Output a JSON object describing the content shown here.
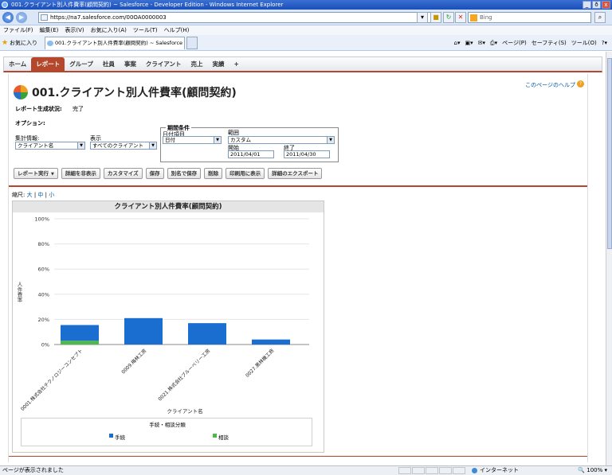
{
  "browser": {
    "window_title": "001.クライアント別人件費率(顧問契約) ~ Salesforce - Developer Edition - Windows Internet Explorer",
    "window_controls": [
      "_",
      "ð",
      "x"
    ],
    "url": "https://na7.salesforce.com/00OA0000003",
    "search_placeholder": "Bing",
    "menu": [
      "ファイル(F)",
      "編集(E)",
      "表示(V)",
      "お気に入り(A)",
      "ツール(T)",
      "ヘルプ(H)"
    ],
    "favorites_label": "お気に入り",
    "tab_title": "001.クライアント別人件費率(顧問契約) ~ Salesforce ...",
    "command_bar": [
      "ページ(P)",
      "セーフティ(S)",
      "ツール(O)"
    ],
    "status_text": "ページが表示されました",
    "zone": "インターネット",
    "zoom": "100%"
  },
  "sf_tabs": [
    {
      "label": "ホーム",
      "active": false
    },
    {
      "label": "レポート",
      "active": true
    },
    {
      "label": "グループ",
      "active": false
    },
    {
      "label": "社員",
      "active": false
    },
    {
      "label": "事案",
      "active": false
    },
    {
      "label": "クライアント",
      "active": false
    },
    {
      "label": "売上",
      "active": false
    },
    {
      "label": "実績",
      "active": false
    },
    {
      "label": "+",
      "active": false
    }
  ],
  "page": {
    "title": "001.クライアント別人件費率(顧問契約)",
    "help_link": "このページのヘルプ",
    "report_status_label": "レポート生成状況:",
    "report_status_value": "完了",
    "options_label": "オプション:",
    "summary_label": "集計情報:",
    "summary_value": "クライアント名",
    "show_label": "表示",
    "show_value": "すべてのクライアント",
    "period_legend": "期間条件",
    "date_field_label": "日付項目",
    "date_field_value": "日付",
    "range_label": "範囲",
    "range_value": "カスタム",
    "start_label": "開始",
    "start_value": "2011/04/01",
    "end_label": "終了",
    "end_value": "2011/04/30"
  },
  "buttons": {
    "run": "レポート実行",
    "hide_details": "詳細を非表示",
    "customize": "カスタマイズ",
    "save": "保存",
    "save_as": "別名で保存",
    "delete": "削除",
    "printable": "印刷用に表示",
    "export": "詳細のエクスポート"
  },
  "size_links": {
    "label": "縮尺:",
    "large": "大",
    "medium": "中",
    "small": "小"
  },
  "chart_data": {
    "type": "bar",
    "stacked": true,
    "title": "クライアント別人件費率(顧問契約)",
    "xlabel": "クライアント名",
    "ylabel": "人件費率",
    "ylim": [
      0,
      100
    ],
    "yticks": [
      "0%",
      "20%",
      "40%",
      "60%",
      "80%",
      "100%"
    ],
    "categories": [
      "0001.株式会社テクノロジーコンセプト",
      "0009.梅林工房",
      "0021.株式会社ブルーベリー工房",
      "0027.黒林機工商"
    ],
    "series": [
      {
        "name": "相談",
        "color": "#4fb84a",
        "values": [
          3,
          0,
          0,
          0
        ]
      },
      {
        "name": "手続",
        "color": "#1a6ed0",
        "values": [
          12.5,
          21,
          17,
          4
        ]
      }
    ],
    "legend_title": "手続・相談分類",
    "legend_position": "bottom",
    "grid": true
  }
}
